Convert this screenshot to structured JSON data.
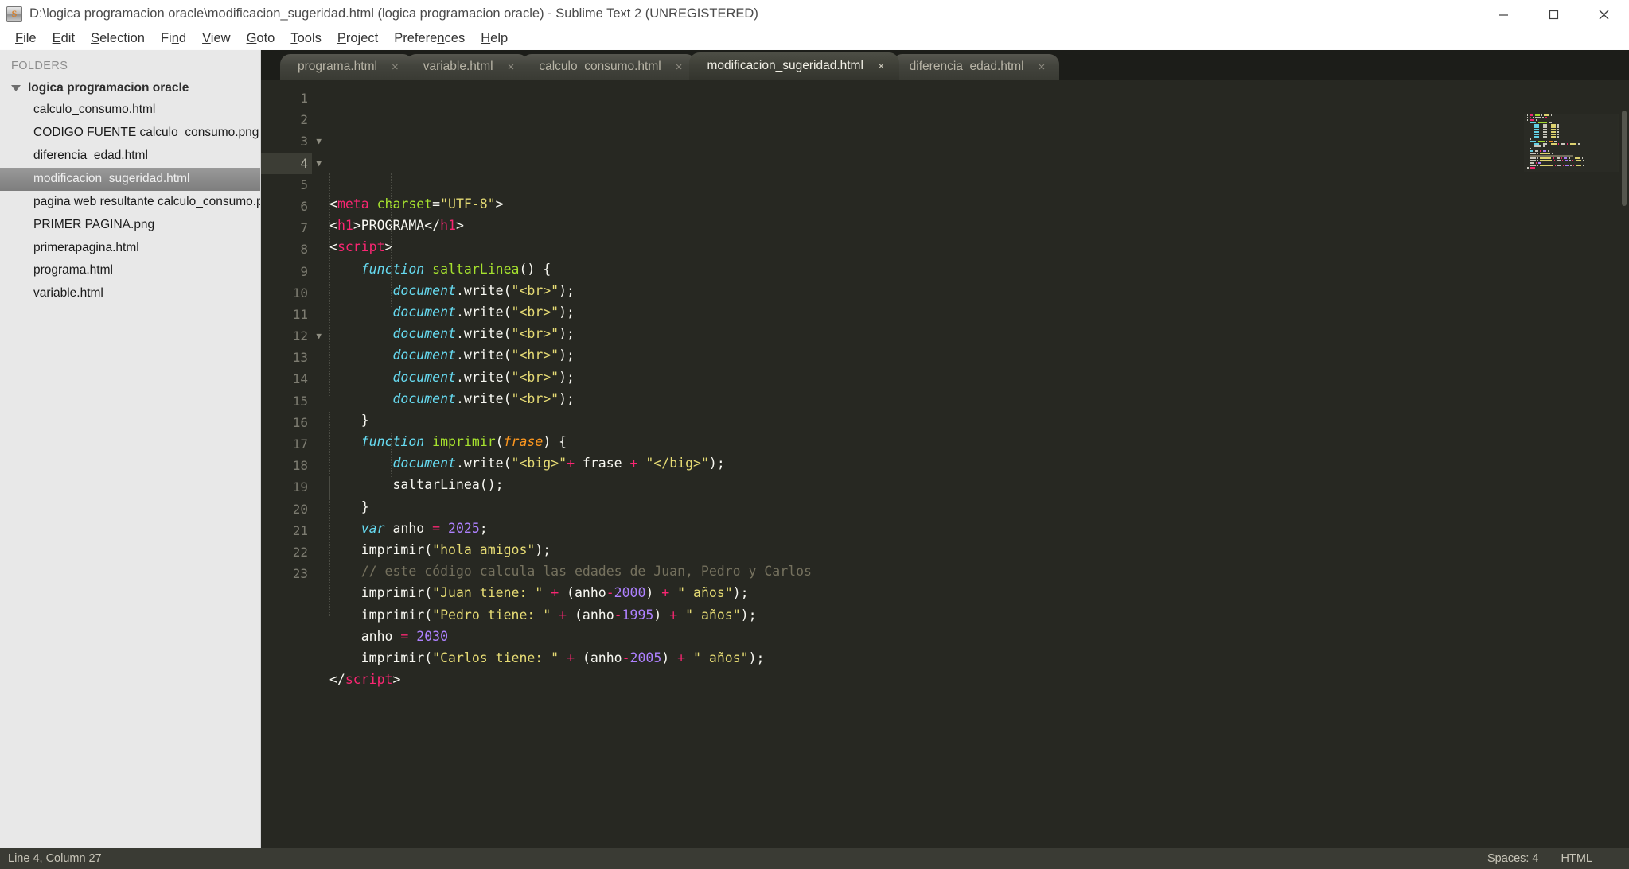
{
  "window": {
    "title": "D:\\logica programacion oracle\\modificacion_sugeridad.html (logica programacion oracle) - Sublime Text 2 (UNREGISTERED)",
    "app_icon": "sublime-text-icon",
    "minimize_label": "Minimize",
    "maximize_label": "Maximize",
    "close_label": "Close"
  },
  "menu": {
    "items": [
      {
        "label": "File",
        "accel": "F"
      },
      {
        "label": "Edit",
        "accel": "E"
      },
      {
        "label": "Selection",
        "accel": "S"
      },
      {
        "label": "Find",
        "accel": "n"
      },
      {
        "label": "View",
        "accel": "V"
      },
      {
        "label": "Goto",
        "accel": "G"
      },
      {
        "label": "Tools",
        "accel": "T"
      },
      {
        "label": "Project",
        "accel": "P"
      },
      {
        "label": "Preferences",
        "accel": "n"
      },
      {
        "label": "Help",
        "accel": "H"
      }
    ]
  },
  "sidebar": {
    "header": "FOLDERS",
    "root": "logica programacion oracle",
    "files": [
      {
        "name": "calculo_consumo.html",
        "selected": false
      },
      {
        "name": "CODIGO FUENTE calculo_consumo.png",
        "selected": false
      },
      {
        "name": "diferencia_edad.html",
        "selected": false
      },
      {
        "name": "modificacion_sugeridad.html",
        "selected": true
      },
      {
        "name": "pagina web resultante  calculo_consumo.png",
        "selected": false
      },
      {
        "name": "PRIMER PAGINA.png",
        "selected": false
      },
      {
        "name": "primerapagina.html",
        "selected": false
      },
      {
        "name": "programa.html",
        "selected": false
      },
      {
        "name": "variable.html",
        "selected": false
      }
    ]
  },
  "tabs": [
    {
      "label": "programa.html",
      "active": false,
      "close": "×"
    },
    {
      "label": "variable.html",
      "active": false,
      "close": "×"
    },
    {
      "label": "calculo_consumo.html",
      "active": false,
      "close": "×"
    },
    {
      "label": "modificacion_sugeridad.html",
      "active": true,
      "close": "×"
    },
    {
      "label": "diferencia_edad.html",
      "active": false,
      "close": "×"
    }
  ],
  "editor": {
    "current_line": 4,
    "lines": [
      {
        "n": "1",
        "fold": "",
        "tokens": [
          {
            "t": "t-punc",
            "v": "<"
          },
          {
            "t": "t-tag",
            "v": "meta"
          },
          {
            "t": "t-plain",
            "v": " "
          },
          {
            "t": "t-attr",
            "v": "charset"
          },
          {
            "t": "t-punc",
            "v": "="
          },
          {
            "t": "t-str",
            "v": "\"UTF-8\""
          },
          {
            "t": "t-punc",
            "v": ">"
          }
        ]
      },
      {
        "n": "2",
        "fold": "",
        "tokens": [
          {
            "t": "t-punc",
            "v": "<"
          },
          {
            "t": "t-tag",
            "v": "h1"
          },
          {
            "t": "t-punc",
            "v": ">"
          },
          {
            "t": "t-plain",
            "v": "PROGRAMA"
          },
          {
            "t": "t-punc",
            "v": "</"
          },
          {
            "t": "t-tag",
            "v": "h1"
          },
          {
            "t": "t-punc",
            "v": ">"
          }
        ]
      },
      {
        "n": "3",
        "fold": "▼",
        "tokens": [
          {
            "t": "t-punc",
            "v": "<"
          },
          {
            "t": "t-tag",
            "v": "script"
          },
          {
            "t": "t-punc",
            "v": ">"
          }
        ]
      },
      {
        "n": "4",
        "fold": "▼",
        "tokens": [
          {
            "t": "t-plain",
            "v": "    "
          },
          {
            "t": "t-kw",
            "v": "function"
          },
          {
            "t": "t-plain",
            "v": " "
          },
          {
            "t": "t-fn",
            "v": "saltarLinea"
          },
          {
            "t": "t-punc",
            "v": "() {"
          }
        ]
      },
      {
        "n": "5",
        "fold": "",
        "tokens": [
          {
            "t": "t-plain",
            "v": "        "
          },
          {
            "t": "t-var",
            "v": "document"
          },
          {
            "t": "t-punc",
            "v": "."
          },
          {
            "t": "t-plain",
            "v": "write"
          },
          {
            "t": "t-punc",
            "v": "("
          },
          {
            "t": "t-str",
            "v": "\"<br>\""
          },
          {
            "t": "t-punc",
            "v": ");"
          }
        ]
      },
      {
        "n": "6",
        "fold": "",
        "tokens": [
          {
            "t": "t-plain",
            "v": "        "
          },
          {
            "t": "t-var",
            "v": "document"
          },
          {
            "t": "t-punc",
            "v": "."
          },
          {
            "t": "t-plain",
            "v": "write"
          },
          {
            "t": "t-punc",
            "v": "("
          },
          {
            "t": "t-str",
            "v": "\"<br>\""
          },
          {
            "t": "t-punc",
            "v": ");"
          }
        ]
      },
      {
        "n": "7",
        "fold": "",
        "tokens": [
          {
            "t": "t-plain",
            "v": "        "
          },
          {
            "t": "t-var",
            "v": "document"
          },
          {
            "t": "t-punc",
            "v": "."
          },
          {
            "t": "t-plain",
            "v": "write"
          },
          {
            "t": "t-punc",
            "v": "("
          },
          {
            "t": "t-str",
            "v": "\"<br>\""
          },
          {
            "t": "t-punc",
            "v": ");"
          }
        ]
      },
      {
        "n": "8",
        "fold": "",
        "tokens": [
          {
            "t": "t-plain",
            "v": "        "
          },
          {
            "t": "t-var",
            "v": "document"
          },
          {
            "t": "t-punc",
            "v": "."
          },
          {
            "t": "t-plain",
            "v": "write"
          },
          {
            "t": "t-punc",
            "v": "("
          },
          {
            "t": "t-str",
            "v": "\"<hr>\""
          },
          {
            "t": "t-punc",
            "v": ");"
          }
        ]
      },
      {
        "n": "9",
        "fold": "",
        "tokens": [
          {
            "t": "t-plain",
            "v": "        "
          },
          {
            "t": "t-var",
            "v": "document"
          },
          {
            "t": "t-punc",
            "v": "."
          },
          {
            "t": "t-plain",
            "v": "write"
          },
          {
            "t": "t-punc",
            "v": "("
          },
          {
            "t": "t-str",
            "v": "\"<br>\""
          },
          {
            "t": "t-punc",
            "v": ");"
          }
        ]
      },
      {
        "n": "10",
        "fold": "",
        "tokens": [
          {
            "t": "t-plain",
            "v": "        "
          },
          {
            "t": "t-var",
            "v": "document"
          },
          {
            "t": "t-punc",
            "v": "."
          },
          {
            "t": "t-plain",
            "v": "write"
          },
          {
            "t": "t-punc",
            "v": "("
          },
          {
            "t": "t-str",
            "v": "\"<br>\""
          },
          {
            "t": "t-punc",
            "v": ");"
          }
        ]
      },
      {
        "n": "11",
        "fold": "",
        "tokens": [
          {
            "t": "t-plain",
            "v": "    "
          },
          {
            "t": "t-punc",
            "v": "}"
          }
        ]
      },
      {
        "n": "12",
        "fold": "▼",
        "tokens": [
          {
            "t": "t-plain",
            "v": "    "
          },
          {
            "t": "t-kw",
            "v": "function"
          },
          {
            "t": "t-plain",
            "v": " "
          },
          {
            "t": "t-fn",
            "v": "imprimir"
          },
          {
            "t": "t-punc",
            "v": "("
          },
          {
            "t": "t-param",
            "v": "frase"
          },
          {
            "t": "t-punc",
            "v": ") {"
          }
        ]
      },
      {
        "n": "13",
        "fold": "",
        "tokens": [
          {
            "t": "t-plain",
            "v": "        "
          },
          {
            "t": "t-var",
            "v": "document"
          },
          {
            "t": "t-punc",
            "v": "."
          },
          {
            "t": "t-plain",
            "v": "write"
          },
          {
            "t": "t-punc",
            "v": "("
          },
          {
            "t": "t-str",
            "v": "\"<big>\""
          },
          {
            "t": "t-op",
            "v": "+"
          },
          {
            "t": "t-plain",
            "v": " frase "
          },
          {
            "t": "t-op",
            "v": "+"
          },
          {
            "t": "t-plain",
            "v": " "
          },
          {
            "t": "t-str",
            "v": "\"</big>\""
          },
          {
            "t": "t-punc",
            "v": ");"
          }
        ]
      },
      {
        "n": "14",
        "fold": "",
        "tokens": [
          {
            "t": "t-plain",
            "v": "        "
          },
          {
            "t": "t-plain",
            "v": "saltarLinea"
          },
          {
            "t": "t-punc",
            "v": "();"
          }
        ]
      },
      {
        "n": "15",
        "fold": "",
        "tokens": [
          {
            "t": "t-plain",
            "v": "    "
          },
          {
            "t": "t-punc",
            "v": "}"
          }
        ]
      },
      {
        "n": "16",
        "fold": "",
        "tokens": [
          {
            "t": "t-plain",
            "v": "    "
          },
          {
            "t": "t-kw",
            "v": "var"
          },
          {
            "t": "t-plain",
            "v": " anho "
          },
          {
            "t": "t-op",
            "v": "="
          },
          {
            "t": "t-plain",
            "v": " "
          },
          {
            "t": "t-num",
            "v": "2025"
          },
          {
            "t": "t-punc",
            "v": ";"
          }
        ]
      },
      {
        "n": "17",
        "fold": "",
        "tokens": [
          {
            "t": "t-plain",
            "v": "    "
          },
          {
            "t": "t-plain",
            "v": "imprimir"
          },
          {
            "t": "t-punc",
            "v": "("
          },
          {
            "t": "t-str",
            "v": "\"hola amigos\""
          },
          {
            "t": "t-punc",
            "v": ");"
          }
        ]
      },
      {
        "n": "18",
        "fold": "",
        "tokens": [
          {
            "t": "t-plain",
            "v": "    "
          },
          {
            "t": "t-comment",
            "v": "// este código calcula las edades de Juan, Pedro y Carlos"
          }
        ]
      },
      {
        "n": "19",
        "fold": "",
        "tokens": [
          {
            "t": "t-plain",
            "v": "    "
          },
          {
            "t": "t-plain",
            "v": "imprimir"
          },
          {
            "t": "t-punc",
            "v": "("
          },
          {
            "t": "t-str",
            "v": "\"Juan tiene: \""
          },
          {
            "t": "t-plain",
            "v": " "
          },
          {
            "t": "t-op",
            "v": "+"
          },
          {
            "t": "t-plain",
            "v": " (anho"
          },
          {
            "t": "t-op",
            "v": "-"
          },
          {
            "t": "t-num",
            "v": "2000"
          },
          {
            "t": "t-plain",
            "v": ") "
          },
          {
            "t": "t-op",
            "v": "+"
          },
          {
            "t": "t-plain",
            "v": " "
          },
          {
            "t": "t-str",
            "v": "\" años\""
          },
          {
            "t": "t-punc",
            "v": ");"
          }
        ]
      },
      {
        "n": "20",
        "fold": "",
        "tokens": [
          {
            "t": "t-plain",
            "v": "    "
          },
          {
            "t": "t-plain",
            "v": "imprimir"
          },
          {
            "t": "t-punc",
            "v": "("
          },
          {
            "t": "t-str",
            "v": "\"Pedro tiene: \""
          },
          {
            "t": "t-plain",
            "v": " "
          },
          {
            "t": "t-op",
            "v": "+"
          },
          {
            "t": "t-plain",
            "v": " (anho"
          },
          {
            "t": "t-op",
            "v": "-"
          },
          {
            "t": "t-num",
            "v": "1995"
          },
          {
            "t": "t-plain",
            "v": ") "
          },
          {
            "t": "t-op",
            "v": "+"
          },
          {
            "t": "t-plain",
            "v": " "
          },
          {
            "t": "t-str",
            "v": "\" años\""
          },
          {
            "t": "t-punc",
            "v": ");"
          }
        ]
      },
      {
        "n": "21",
        "fold": "",
        "tokens": [
          {
            "t": "t-plain",
            "v": "    anho "
          },
          {
            "t": "t-op",
            "v": "="
          },
          {
            "t": "t-plain",
            "v": " "
          },
          {
            "t": "t-num",
            "v": "2030"
          }
        ]
      },
      {
        "n": "22",
        "fold": "",
        "tokens": [
          {
            "t": "t-plain",
            "v": "    "
          },
          {
            "t": "t-plain",
            "v": "imprimir"
          },
          {
            "t": "t-punc",
            "v": "("
          },
          {
            "t": "t-str",
            "v": "\"Carlos tiene: \""
          },
          {
            "t": "t-plain",
            "v": " "
          },
          {
            "t": "t-op",
            "v": "+"
          },
          {
            "t": "t-plain",
            "v": " (anho"
          },
          {
            "t": "t-op",
            "v": "-"
          },
          {
            "t": "t-num",
            "v": "2005"
          },
          {
            "t": "t-plain",
            "v": ") "
          },
          {
            "t": "t-op",
            "v": "+"
          },
          {
            "t": "t-plain",
            "v": " "
          },
          {
            "t": "t-str",
            "v": "\" años\""
          },
          {
            "t": "t-punc",
            "v": ");"
          }
        ]
      },
      {
        "n": "23",
        "fold": "",
        "tokens": [
          {
            "t": "t-punc",
            "v": "</"
          },
          {
            "t": "t-tag",
            "v": "script"
          },
          {
            "t": "t-punc",
            "v": ">"
          }
        ]
      }
    ]
  },
  "statusbar": {
    "position": "Line 4, Column 27",
    "indentation": "Spaces: 4",
    "syntax": "HTML"
  },
  "colors": {
    "editor_bg": "#272822",
    "tabbar_bg": "#1c1d19",
    "sidebar_bg": "#e8e8e8",
    "statusbar_bg": "#3a3b34",
    "titlebar_bg": "#ffffff",
    "accent_tag": "#f92672",
    "accent_string": "#e6db74",
    "accent_keyword": "#66d9ef",
    "accent_function": "#a6e22e",
    "accent_number": "#ae81ff",
    "accent_comment": "#75715e"
  }
}
